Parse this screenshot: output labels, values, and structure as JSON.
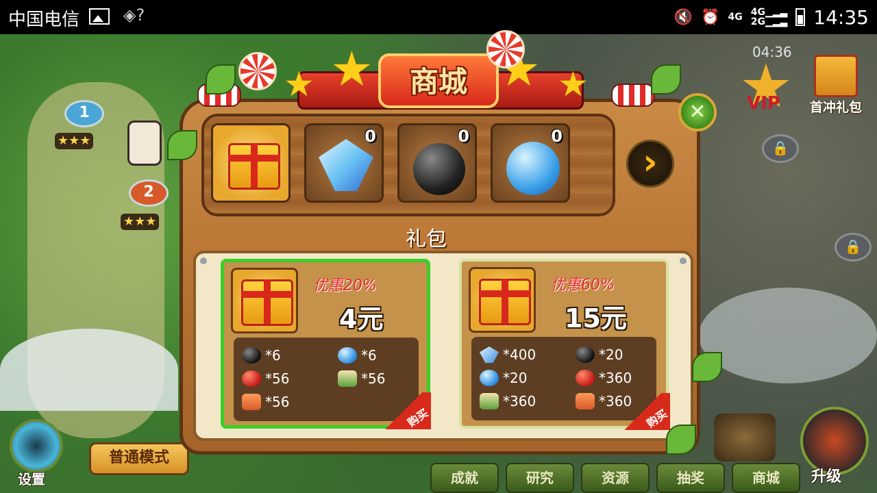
{
  "status_bar": {
    "carrier": "中国电信",
    "network_top": "4G",
    "network_mid": "4G",
    "network_bottom": "2G",
    "time": "14:35"
  },
  "map": {
    "levels": [
      "1",
      "2"
    ],
    "stars_row": "★★★",
    "hud_timer": "04:36",
    "vip_label": "VIP",
    "first_recharge_label": "首冲礼包",
    "settings_label": "设置",
    "mode_label": "普通模式",
    "nav": [
      "成就",
      "研究",
      "资源",
      "抽奖",
      "商城"
    ],
    "upgrade_label": "升级"
  },
  "shop": {
    "title": "商城",
    "close_icon": "close-x-icon",
    "tabs": [
      {
        "icon": "gift-icon",
        "count": ""
      },
      {
        "icon": "diamond-icon",
        "count": "0"
      },
      {
        "icon": "bomb-icon",
        "count": "0"
      },
      {
        "icon": "ice-bomb-icon",
        "count": "0"
      }
    ],
    "next_icon": "chevron-right-icon",
    "section_title": "礼包",
    "packs": [
      {
        "discount": "优惠20%",
        "price": "4元",
        "buy_label": "购买",
        "items": [
          {
            "icon": "bomb-icon",
            "qty": "*6"
          },
          {
            "icon": "ice-bomb-icon",
            "qty": "*6"
          },
          {
            "icon": "apple-icon",
            "qty": "*56"
          },
          {
            "icon": "sushi-icon",
            "qty": "*56"
          },
          {
            "icon": "salmon-icon",
            "qty": "*56"
          }
        ]
      },
      {
        "discount": "优惠60%",
        "price": "15元",
        "buy_label": "购买",
        "items": [
          {
            "icon": "diamond-icon",
            "qty": "*400"
          },
          {
            "icon": "bomb-icon",
            "qty": "*20"
          },
          {
            "icon": "ice-bomb-icon",
            "qty": "*20"
          },
          {
            "icon": "apple-icon",
            "qty": "*360"
          },
          {
            "icon": "sushi-icon",
            "qty": "*360"
          },
          {
            "icon": "salmon-icon",
            "qty": "*360"
          }
        ]
      }
    ]
  }
}
